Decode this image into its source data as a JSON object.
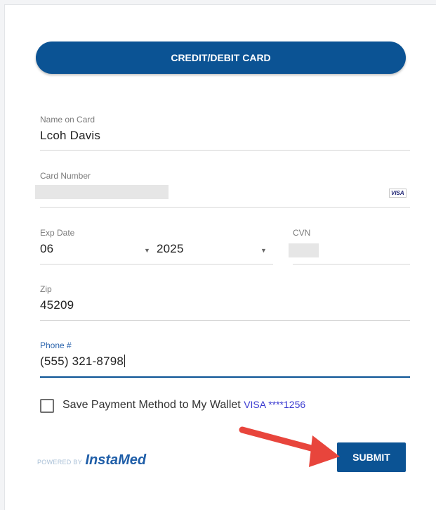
{
  "tab": {
    "label": "CREDIT/DEBIT CARD"
  },
  "fields": {
    "name": {
      "label": "Name on Card",
      "value": "Lcoh Davis"
    },
    "card_number": {
      "label": "Card Number",
      "brand": "VISA"
    },
    "exp": {
      "label": "Exp Date",
      "month": "06",
      "year": "2025"
    },
    "cvn": {
      "label": "CVN"
    },
    "zip": {
      "label": "Zip",
      "value": "45209"
    },
    "phone": {
      "label": "Phone #",
      "value": "(555) 321-8798"
    }
  },
  "wallet": {
    "label": "Save Payment Method to My Wallet",
    "card": "VISA ****1256",
    "checked": false
  },
  "submit": {
    "label": "SUBMIT"
  },
  "footer": {
    "powered_by": "POWERED BY",
    "brand": "InstaMed"
  },
  "colors": {
    "primary": "#0b5394",
    "annotation_arrow": "#e8453c"
  }
}
